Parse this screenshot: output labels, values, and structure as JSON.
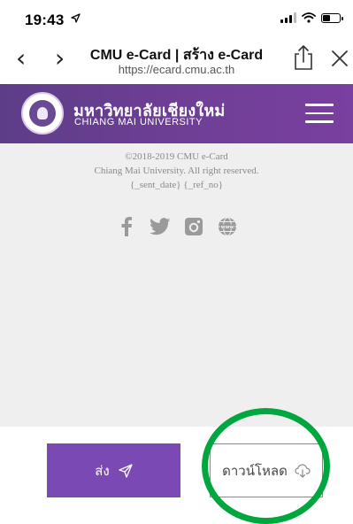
{
  "status_bar": {
    "time": "19:43"
  },
  "browser": {
    "title": "CMU e-Card | สร้าง e-Card",
    "url": "https://ecard.cmu.ac.th",
    "back_glyph": "‹",
    "forward_glyph": "›"
  },
  "site": {
    "university_thai": "มหาวิทยาลัยเชียงใหม่",
    "university_en": "CHIANG MAI UNIVERSITY"
  },
  "footer": {
    "copyright": "©2018-2019 CMU e-Card",
    "rights": "Chiang Mai University. All right reserved.",
    "placeholders": "{_sent_date} {_ref_no}",
    "social_icons": [
      "facebook-icon",
      "twitter-icon",
      "instagram-icon",
      "web-icon"
    ]
  },
  "actions": {
    "send_label": "ส่ง",
    "download_label": "ดาวน์โหลด"
  },
  "colors": {
    "header_purple": "#6f3f96",
    "send_button": "#7a49b4",
    "highlight_circle": "#00a63e",
    "content_bg": "#efefef"
  }
}
